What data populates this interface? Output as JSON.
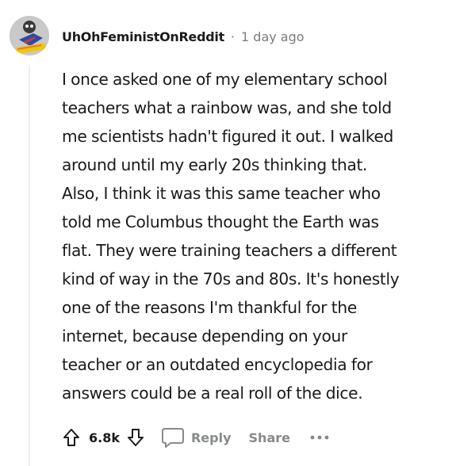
{
  "comment": {
    "author": "UhOhFeministOnReddit",
    "separator": "·",
    "timestamp": "1 day ago",
    "body_lines": [
      "I once asked one of my elementary school",
      "teachers what a rainbow was, and she told",
      "me scientists hadn't figured it out. I walked",
      "around until my early 20s thinking that.",
      "Also, I think it was this same teacher who",
      "told me Columbus thought the Earth was",
      "flat. They were training teachers a different",
      "kind of way in the 70s and 80s. It's honestly",
      "one of the reasons I'm thankful for the",
      "internet, because depending on your",
      "teacher or an outdated encyclopedia for",
      "answers could be a real roll of the dice."
    ]
  },
  "actions": {
    "upvote_icon": "upvote-arrow-icon",
    "score": "6.8k",
    "downvote_icon": "downvote-arrow-icon",
    "reply_icon": "speech-bubble-icon",
    "reply_label": "Reply",
    "share_label": "Share",
    "more_icon": "ellipsis-icon"
  },
  "colors": {
    "text": "#1a1a1b",
    "meta": "#7c7c7c",
    "action_label": "#878a8c",
    "thread_line": "#edeff1"
  }
}
